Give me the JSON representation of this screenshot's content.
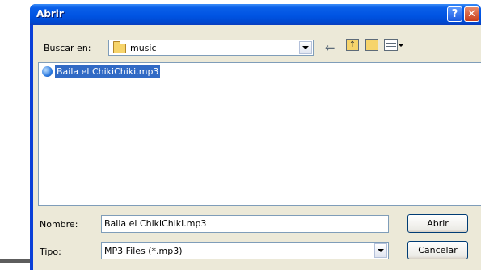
{
  "window": {
    "title": "Abrir"
  },
  "titlebar_buttons": {
    "help": "?",
    "close": "✕"
  },
  "lookin": {
    "label": "Buscar en:",
    "value": "music"
  },
  "toolbar": {
    "back_icon": "back-arrow-icon",
    "up_icon": "up-folder-icon",
    "newfolder_icon": "new-folder-icon",
    "view_icon": "view-menu-icon"
  },
  "files": [
    {
      "name": "Baila el ChikiChiki.mp3",
      "icon": "mp3-audio-icon",
      "selected": true
    }
  ],
  "filename": {
    "label": "Nombre:",
    "value": "Baila el ChikiChiki.mp3"
  },
  "filetype": {
    "label": "Tipo:",
    "value": "MP3 Files (*.mp3)"
  },
  "buttons": {
    "open": "Abrir",
    "cancel": "Cancelar"
  }
}
